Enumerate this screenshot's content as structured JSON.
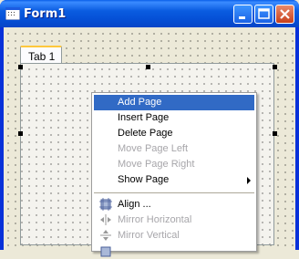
{
  "window": {
    "title": "Form1"
  },
  "tabs": [
    {
      "label": "Tab 1"
    }
  ],
  "menu": {
    "items": [
      {
        "label": "Add Page",
        "state": "selected"
      },
      {
        "label": "Insert Page",
        "state": "enabled"
      },
      {
        "label": "Delete Page",
        "state": "enabled"
      },
      {
        "label": "Move Page Left",
        "state": "disabled"
      },
      {
        "label": "Move Page Right",
        "state": "disabled"
      },
      {
        "label": "Show Page",
        "state": "enabled",
        "submenu": true
      },
      {
        "label": "Align ...",
        "state": "enabled",
        "icon": "align-icon"
      },
      {
        "label": "Mirror Horizontal",
        "state": "disabled",
        "icon": "mirror-horizontal-icon"
      },
      {
        "label": "Mirror Vertical",
        "state": "disabled",
        "icon": "mirror-vertical-icon"
      }
    ]
  },
  "colors": {
    "title_bar": "#0a5ce0",
    "highlight": "#316ac5",
    "form_background": "#ece9d8",
    "tab_accent": "#ffc83c"
  }
}
